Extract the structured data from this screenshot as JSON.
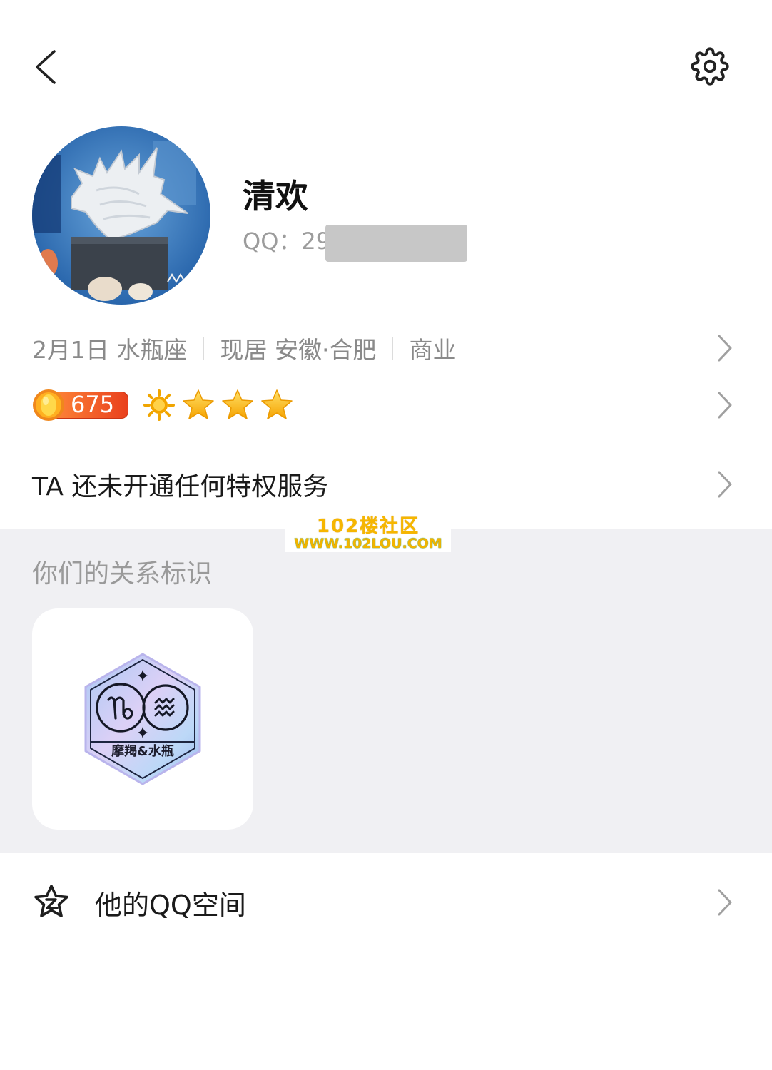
{
  "header": {
    "back_icon": "chevron-left-icon",
    "settings_icon": "gear-icon"
  },
  "profile": {
    "name": "清欢",
    "qq_text": "QQ：29"
  },
  "info_row": {
    "segments": [
      "2月1日 水瓶座",
      "现居 安徽·合肥",
      "商业"
    ]
  },
  "level_row": {
    "level_value": "675",
    "level_icons": [
      "coin-icon",
      "sun-icon",
      "star-icon",
      "star-icon",
      "star-icon"
    ]
  },
  "privilege_row": {
    "text": "TA 还未开通任何特权服务"
  },
  "watermark": {
    "title": "102楼社区",
    "url": "WWW.102LOU.COM"
  },
  "relationship": {
    "title": "你们的关系标识",
    "badge": {
      "label": "摩羯&水瓶",
      "icons": [
        "capricorn-icon",
        "aquarius-icon",
        "sparkle-icon"
      ]
    }
  },
  "qzone_row": {
    "label": "他的QQ空间",
    "icon": "qzone-star-icon"
  },
  "colors": {
    "text_primary": "#1a1a1a",
    "text_secondary": "#8a8a8a",
    "section_bg": "#f0f0f3",
    "level_badge": "#e9401d",
    "star_gold": "#f7b500",
    "chevron": "#a0a0a0"
  }
}
